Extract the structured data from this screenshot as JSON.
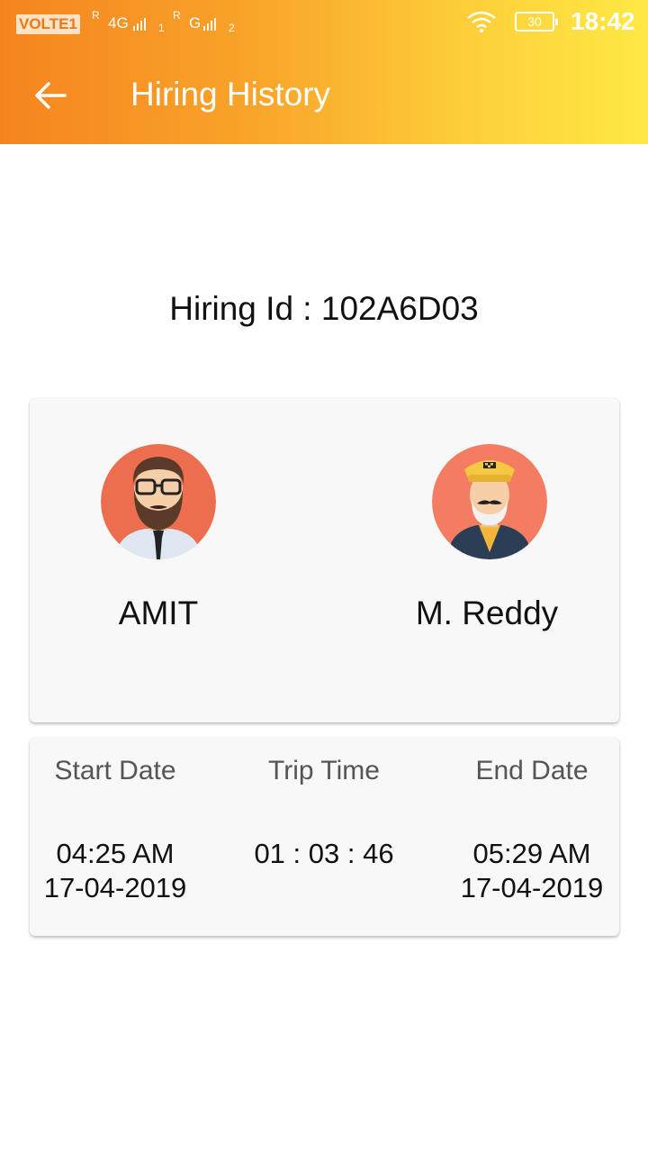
{
  "status_bar": {
    "volte": "VOLTE1",
    "roaming1": "R",
    "network1": "4G",
    "sim1_index": "1",
    "roaming2": "R",
    "network2": "G",
    "sim2_index": "2",
    "battery": "30",
    "time": "18:42"
  },
  "app_bar": {
    "title": "Hiring History",
    "back_icon": "arrow-left-icon"
  },
  "hiring": {
    "id_label": "Hiring Id : 102A6D03"
  },
  "people": {
    "user_name": "AMIT",
    "user_avatar": "bearded-man-avatar-icon",
    "driver_name": "M. Reddy",
    "driver_avatar": "taxi-driver-avatar-icon"
  },
  "trip": {
    "start_label": "Start Date",
    "start_time": "04:25 AM",
    "start_date": "17-04-2019",
    "trip_label": "Trip Time",
    "trip_time": "01 : 03 : 46",
    "end_label": "End Date",
    "end_time": "05:29 AM",
    "end_date": "17-04-2019"
  },
  "colors": {
    "appbar_start": "#f5841f",
    "appbar_end": "#ffe944",
    "card_bg": "#f8f8f8",
    "avatar_bg": "#ec6e4e"
  }
}
